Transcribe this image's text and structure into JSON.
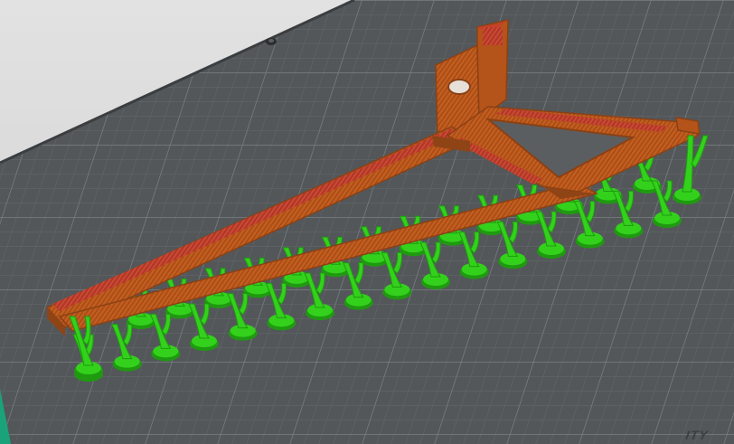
{
  "viewport": {
    "bed_label": "ITY"
  },
  "colors": {
    "bed": "#53575a",
    "bed_grid_minor": "#62676a",
    "bed_grid_major": "#787e82",
    "bed_edge": "#383b3d",
    "perimeter": "#c15f1e",
    "perimeter_dark": "#8a4115",
    "infill": "#b8332a",
    "support": "#33d11c",
    "support_dark": "#1f9a10",
    "corner_accent": "#1aa37a"
  },
  "icons": {
    "bed_screw": "bed-screw-icon"
  }
}
